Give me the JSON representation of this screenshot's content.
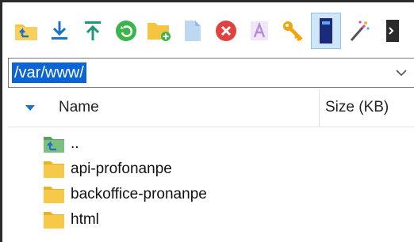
{
  "toolbar": {
    "buttons": [
      {
        "icon": "parent-directory-icon"
      },
      {
        "icon": "download-icon"
      },
      {
        "icon": "upload-icon"
      },
      {
        "icon": "refresh-icon"
      },
      {
        "icon": "new-folder-icon"
      },
      {
        "icon": "new-file-icon"
      },
      {
        "icon": "delete-icon"
      },
      {
        "icon": "rename-icon"
      },
      {
        "icon": "permissions-key-icon"
      },
      {
        "icon": "compare-panel-icon",
        "active": true
      },
      {
        "icon": "magic-wand-icon"
      },
      {
        "icon": "terminal-icon"
      }
    ]
  },
  "path_bar": {
    "value": "/var/www/"
  },
  "file_list": {
    "columns": {
      "name": "Name",
      "size": "Size (KB)"
    },
    "rows": [
      {
        "name": "..",
        "type": "parent"
      },
      {
        "name": "api-profonanpe",
        "type": "folder"
      },
      {
        "name": "backoffice-pronanpe",
        "type": "folder"
      },
      {
        "name": "html",
        "type": "folder"
      }
    ]
  },
  "colors": {
    "selection": "#0a64d6",
    "folder": "#f5c542",
    "accent_blue": "#1a73c9",
    "active_button_bg": "#cfe6f7"
  }
}
